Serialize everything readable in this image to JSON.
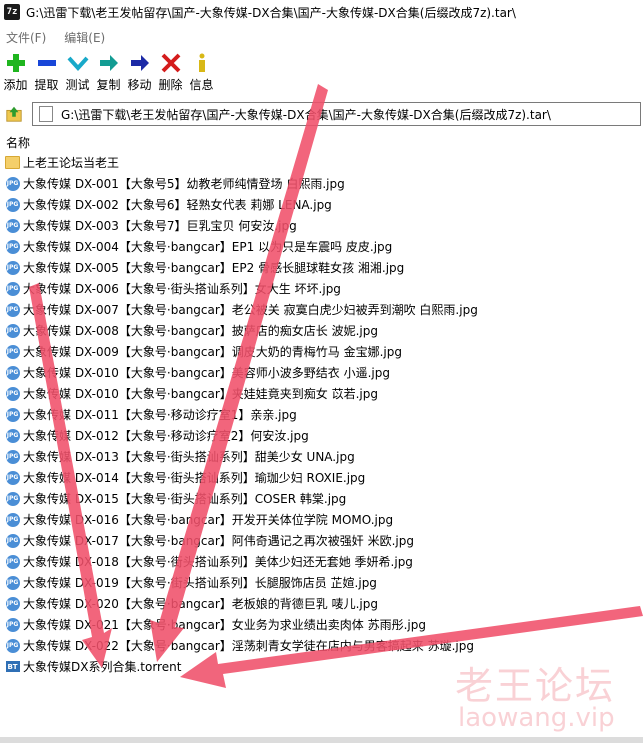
{
  "window": {
    "title": "G:\\迅雷下载\\老王发帖留存\\国产-大象传媒-DX合集\\国产-大象传媒-DX合集(后缀改成7z).tar\\",
    "app_icon_text": "7z"
  },
  "menu": [
    {
      "label": "文件(F)"
    },
    {
      "label": "编辑(E)"
    }
  ],
  "toolbar": [
    {
      "label": "添加",
      "icon": "plus-icon",
      "color": "#1fb51f"
    },
    {
      "label": "提取",
      "icon": "minus-icon",
      "color": "#1846d8"
    },
    {
      "label": "测试",
      "icon": "check-icon",
      "color": "#18a9c9"
    },
    {
      "label": "复制",
      "icon": "copy-arrow-icon",
      "color": "#139c93"
    },
    {
      "label": "移动",
      "icon": "move-arrow-icon",
      "color": "#1c2aa6"
    },
    {
      "label": "删除",
      "icon": "delete-x-icon",
      "color": "#d41c1c"
    },
    {
      "label": "信息",
      "icon": "info-icon",
      "color": "#d8b816"
    }
  ],
  "address": {
    "path": "G:\\迅雷下载\\老王发帖留存\\国产-大象传媒-DX合集\\国产-大象传媒-DX合集(后缀改成7z).tar\\"
  },
  "list_header": {
    "name": "名称"
  },
  "files": [
    {
      "name": "上老王论坛当老王",
      "type": "folder"
    },
    {
      "name": "大象传媒 DX-001【大象号5】幼教老师纯情登场 白熙雨.jpg",
      "type": "jpg"
    },
    {
      "name": "大象传媒 DX-002【大象号6】轻熟女代表 莉娜 LENA.jpg",
      "type": "jpg"
    },
    {
      "name": "大象传媒 DX-003【大象号7】巨乳宝贝 何安汝.jpg",
      "type": "jpg"
    },
    {
      "name": "大象传媒 DX-004【大象号·bangcar】EP1 以为只是车震吗 皮皮.jpg",
      "type": "jpg"
    },
    {
      "name": "大象传媒 DX-005【大象号·bangcar】EP2 骨感长腿球鞋女孩 湘湘.jpg",
      "type": "jpg"
    },
    {
      "name": "大象传媒 DX-006【大象号·街头搭讪系列】女大生 坏坏.jpg",
      "type": "jpg"
    },
    {
      "name": "大象传媒 DX-007【大象号·bangcar】老公被关 寂寞白虎少妇被弄到潮吹 白熙雨.jpg",
      "type": "jpg"
    },
    {
      "name": "大象传媒 DX-008【大象号·bangcar】披萨店的痴女店长 波妮.jpg",
      "type": "jpg"
    },
    {
      "name": "大象传媒 DX-009【大象号·bangcar】调皮大奶的青梅竹马 金宝娜.jpg",
      "type": "jpg"
    },
    {
      "name": "大象传媒 DX-010【大象号·bangcar】美容师小波多野结衣 小遥.jpg",
      "type": "jpg"
    },
    {
      "name": "大象传媒 DX-010【大象号·bangcar】夹娃娃竟夹到痴女 苡若.jpg",
      "type": "jpg"
    },
    {
      "name": "大象传媒 DX-011【大象号·移动诊疗室1】亲亲.jpg",
      "type": "jpg"
    },
    {
      "name": "大象传媒 DX-012【大象号·移动诊疗室2】何安汝.jpg",
      "type": "jpg"
    },
    {
      "name": "大象传媒 DX-013【大象号·街头搭讪系列】甜美少女 UNA.jpg",
      "type": "jpg"
    },
    {
      "name": "大象传媒 DX-014【大象号·街头搭讪系列】瑜珈少妇 ROXIE.jpg",
      "type": "jpg"
    },
    {
      "name": "大象传媒 DX-015【大象号·街头搭讪系列】COSER 韩棠.jpg",
      "type": "jpg"
    },
    {
      "name": "大象传媒 DX-016【大象号·bangcar】开发开关体位学院 MOMO.jpg",
      "type": "jpg"
    },
    {
      "name": "大象传媒 DX-017【大象号·bangcar】阿伟奇遇记之再次被强奸 米欧.jpg",
      "type": "jpg"
    },
    {
      "name": "大象传媒 DX-018【大象号·街头搭讪系列】美体少妇还无套她 季妍希.jpg",
      "type": "jpg"
    },
    {
      "name": "大象传媒 DX-019【大象号·街头搭讪系列】长腿服饰店员 芷媗.jpg",
      "type": "jpg"
    },
    {
      "name": "大象传媒 DX-020【大象号·bangcar】老板娘的背德巨乳 唛儿.jpg",
      "type": "jpg"
    },
    {
      "name": "大象传媒 DX-021【大象号·bangcar】女业务为求业绩出卖肉体 苏雨彤.jpg",
      "type": "jpg"
    },
    {
      "name": "大象传媒 DX-022【大象号·bangcar】淫荡刺青女学徒在店内与男客搞起来 苏璇.jpg",
      "type": "jpg"
    },
    {
      "name": "大象传媒DX系列合集.torrent",
      "type": "torrent"
    }
  ],
  "watermark": {
    "line1": "老王论坛",
    "line2": "laowang.vip"
  },
  "annotation_color": "#f0506a"
}
